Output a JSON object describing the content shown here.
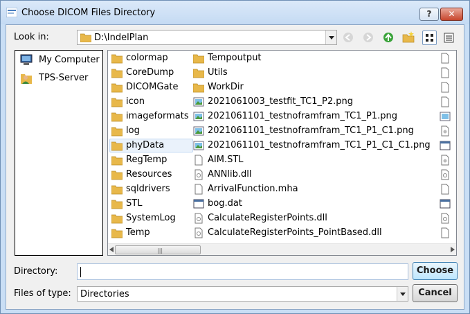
{
  "window": {
    "title": "Choose DICOM Files Directory",
    "help_label": "?",
    "close_label": "✕"
  },
  "toolbar": {
    "look_in_label": "Look in:",
    "look_in_value": "D:\\IndelPlan"
  },
  "places": [
    {
      "label": "My Computer",
      "icon": "computer-icon"
    },
    {
      "label": "TPS-Server",
      "icon": "user-icon"
    }
  ],
  "files": {
    "col1": [
      "colormap",
      "CoreDump",
      "DICOMGate",
      "icon",
      "imageformats",
      "log",
      "phyData",
      "RegTemp",
      "Resources",
      "sqldrivers",
      "STL",
      "SystemLog",
      "Temp"
    ],
    "col2": [
      {
        "name": "Tempoutput",
        "icon": "folder-icon"
      },
      {
        "name": "Utils",
        "icon": "folder-icon"
      },
      {
        "name": "WorkDir",
        "icon": "folder-icon"
      },
      {
        "name": "2021061003_testfit_TC1_P2.png",
        "icon": "image-icon"
      },
      {
        "name": "2021061101_testnoframfram_TC1_P1.png",
        "icon": "image-icon"
      },
      {
        "name": "2021061101_testnoframfram_TC1_P1_C1.png",
        "icon": "image-icon"
      },
      {
        "name": "2021061101_testnoframfram_TC1_P1_C1_C1.png",
        "icon": "image-icon"
      },
      {
        "name": "AIM.STL",
        "icon": "file-icon"
      },
      {
        "name": "ANNlib.dll",
        "icon": "dll-icon"
      },
      {
        "name": "ArrivalFunction.mha",
        "icon": "file-icon"
      },
      {
        "name": "bog.dat",
        "icon": "dat-icon"
      },
      {
        "name": "CalculateRegisterPoints.dll",
        "icon": "dll-icon"
      },
      {
        "name": "CalculateRegisterPoints_PointBased.dll",
        "icon": "dll-icon"
      }
    ],
    "selected": "phyData"
  },
  "form": {
    "directory_label": "Directory:",
    "directory_value": "",
    "files_of_type_label": "Files of type:",
    "files_of_type_value": "Directories",
    "choose_label": "Choose",
    "cancel_label": "Cancel"
  },
  "colors": {
    "frame": "#c9def5",
    "selection": "#eaf2fb",
    "folder": "#e8b84a",
    "accent_button": "#bee6fd"
  }
}
